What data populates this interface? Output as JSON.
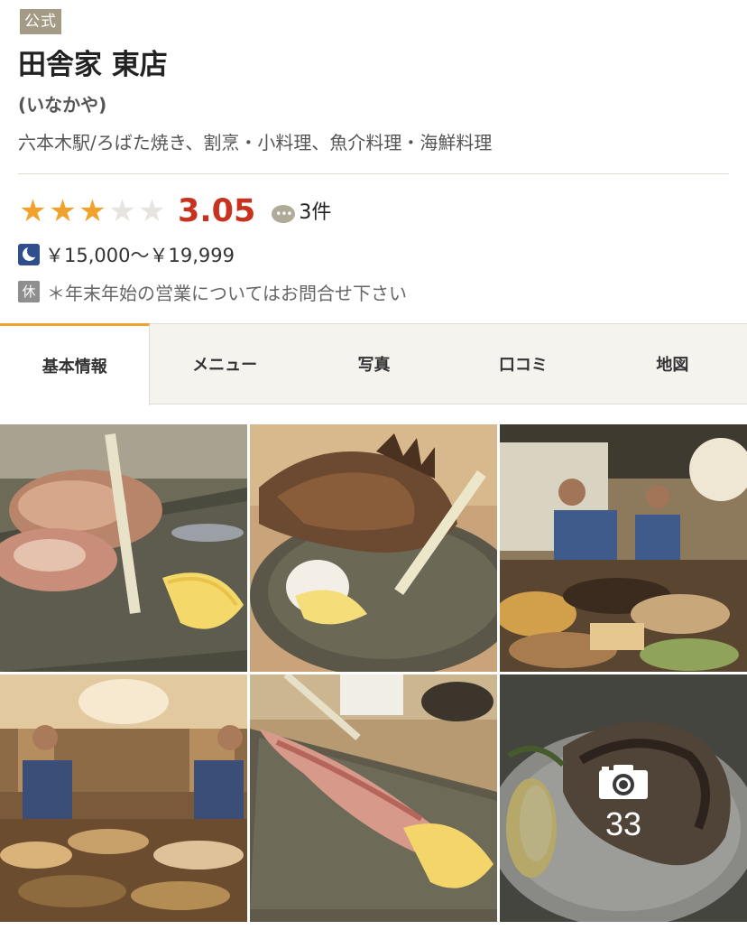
{
  "header": {
    "official_badge": "公式",
    "store_name": "田舎家 東店",
    "store_kana": "(いなかや)",
    "genre": "六本木駅/ろばた焼き、割烹・小料理、魚介料理・海鮮料理"
  },
  "rating": {
    "score": "3.05",
    "stars_filled": 3,
    "stars_total": 5,
    "review_count": "3件",
    "review_icon": "speech-bubble-icon"
  },
  "budget": {
    "icon": "moon-icon",
    "dinner_price": "￥15,000～￥19,999"
  },
  "holiday": {
    "icon_label": "休",
    "text": "＊年末年始の営業についてはお問合せ下さい"
  },
  "tabs": [
    {
      "label": "基本情報",
      "active": true
    },
    {
      "label": "メニュー",
      "active": false
    },
    {
      "label": "写真",
      "active": false
    },
    {
      "label": "口コミ",
      "active": false
    },
    {
      "label": "地図",
      "active": false
    }
  ],
  "photos": {
    "more_count": "33",
    "more_icon": "camera-icon"
  },
  "colors": {
    "accent": "#f0a22c",
    "score": "#c8331f",
    "badge": "#a39b86",
    "moon": "#2f4e8c"
  }
}
